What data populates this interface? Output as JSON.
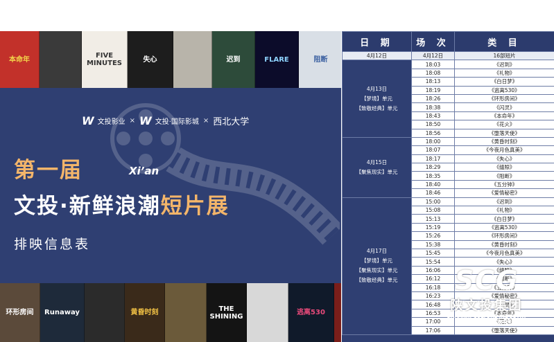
{
  "top_posters": [
    {
      "text": "本命年",
      "bg": "#c2312a",
      "fg": "#f2d34a"
    },
    {
      "text": "",
      "bg": "#3a3a3a",
      "fg": "#ffffff"
    },
    {
      "text": "FIVE MINUTES",
      "bg": "#f1ede6",
      "fg": "#333333"
    },
    {
      "text": "失心",
      "bg": "#1d1d1d",
      "fg": "#ffffff"
    },
    {
      "text": "",
      "bg": "#b8b4aa",
      "fg": "#333333"
    },
    {
      "text": "迟到",
      "bg": "#2d4b3a",
      "fg": "#ffffff"
    },
    {
      "text": "FLARE",
      "bg": "#0c0c2a",
      "fg": "#8fd4ff"
    },
    {
      "text": "阻断",
      "bg": "#d9dfe6",
      "fg": "#3a5fa0"
    },
    {
      "text": "",
      "bg": "#6a1a6e",
      "fg": "#ffcc33"
    }
  ],
  "bottom_posters": [
    {
      "text": "环形房间",
      "bg": "#5b4a3a",
      "fg": "#ffffff"
    },
    {
      "text": "Runaway",
      "bg": "#1e2a3a",
      "fg": "#ffffff"
    },
    {
      "text": "",
      "bg": "#2b2b2b",
      "fg": "#ffffff"
    },
    {
      "text": "黄昏时刻",
      "bg": "#3a2a1a",
      "fg": "#f2c245"
    },
    {
      "text": "",
      "bg": "#6b5a3a",
      "fg": "#ffffff"
    },
    {
      "text": "THE SHINING",
      "bg": "#141414",
      "fg": "#ffffff"
    },
    {
      "text": "",
      "bg": "#d8d8d8",
      "fg": "#333333"
    },
    {
      "text": "逃离530",
      "bg": "#101a2a",
      "fg": "#e84a7a"
    },
    {
      "text": "",
      "bg": "#7a1e1a",
      "fg": "#ffffff"
    }
  ],
  "logos": {
    "brand1": "文投影业",
    "sep1": "×",
    "brand2": "文投·国际影城",
    "sep2": "×",
    "brand3": "西北大学"
  },
  "title": {
    "line1": "第一届",
    "xian": "Xi’an",
    "line2_a": "文投·新鲜浪潮",
    "line2_b": "短片展",
    "line3": "排映信息表"
  },
  "schedule": {
    "headers": [
      "日 期",
      "场 次",
      "类 目"
    ],
    "first_row": {
      "date": "4月12日",
      "time": "4月12日",
      "item": "16部短片"
    },
    "groups": [
      {
        "date": "4月13日",
        "units": [
          "【梦境】单元",
          "【致敬经典】单元"
        ],
        "rows": [
          {
            "time": "18:03",
            "item": "《迟到》"
          },
          {
            "time": "18:08",
            "item": "《礼物》"
          },
          {
            "time": "18:13",
            "item": "《白日梦》"
          },
          {
            "time": "18:19",
            "item": "《逃离530》"
          },
          {
            "time": "18:26",
            "item": "《环形房间》"
          },
          {
            "time": "18:38",
            "item": "《闪灵》"
          },
          {
            "time": "18:43",
            "item": "《本命年》"
          },
          {
            "time": "18:50",
            "item": "《花火》"
          },
          {
            "time": "18:56",
            "item": "《堕落天使》"
          }
        ]
      },
      {
        "date": "4月15日",
        "units": [
          "【聚焦现实】单元"
        ],
        "rows": [
          {
            "time": "18:00",
            "item": "《黄昏时刻》"
          },
          {
            "time": "18:07",
            "item": "《今夜月色真美》"
          },
          {
            "time": "18:17",
            "item": "《失心》"
          },
          {
            "time": "18:29",
            "item": "《缝隙》"
          },
          {
            "time": "18:35",
            "item": "《阻断》"
          },
          {
            "time": "18:40",
            "item": "《五分钟》"
          },
          {
            "time": "18:46",
            "item": "《爱情秘密》"
          }
        ]
      },
      {
        "date": "4月17日",
        "units": [
          "【梦境】单元",
          "【聚焦现实】单元",
          "【致敬经典】单元"
        ],
        "rows": [
          {
            "time": "15:00",
            "item": "《迟到》"
          },
          {
            "time": "15:08",
            "item": "《礼物》"
          },
          {
            "time": "15:13",
            "item": "《白日梦》"
          },
          {
            "time": "15:19",
            "item": "《逃离530》"
          },
          {
            "time": "15:26",
            "item": "《环形房间》"
          },
          {
            "time": "15:38",
            "item": "《黄昏时刻》"
          },
          {
            "time": "15:45",
            "item": "《今夜月色真美》"
          },
          {
            "time": "15:54",
            "item": "《失心》"
          },
          {
            "time": "16:06",
            "item": "《缝隙》"
          },
          {
            "time": "16:12",
            "item": "《阻断》"
          },
          {
            "time": "16:18",
            "item": "《五分钟》"
          },
          {
            "time": "16:23",
            "item": "《爱情秘密》"
          },
          {
            "time": "16:48",
            "item": "《闪灵》"
          },
          {
            "time": "16:53",
            "item": "《本命年》"
          },
          {
            "time": "17:00",
            "item": "《花火》"
          },
          {
            "time": "17:06",
            "item": "《堕落天使》"
          }
        ]
      }
    ]
  },
  "watermark": {
    "logo": "SCG",
    "cn": "陕文投集团",
    "en1": "SHAANXI CULTURE INDUSTRY",
    "en2": "INVESTMENT GROUP"
  }
}
